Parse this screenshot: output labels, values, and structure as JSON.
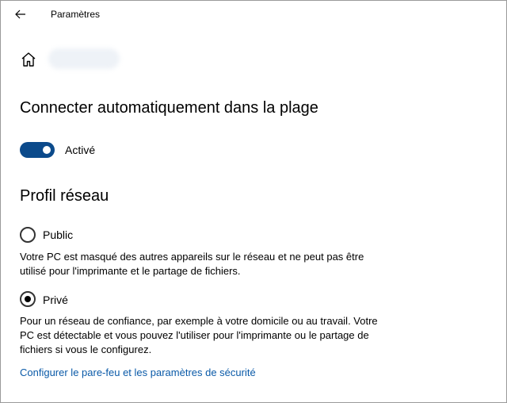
{
  "window": {
    "title": "Paramètres"
  },
  "icons": {
    "back": "back-arrow-icon",
    "home": "home-icon"
  },
  "auto_connect": {
    "heading": "Connecter automatiquement dans la plage",
    "toggle_state": "on",
    "toggle_label": "Activé",
    "accent_color": "#0b4a8b"
  },
  "network_profile": {
    "heading": "Profil réseau",
    "options": [
      {
        "label": "Public",
        "selected": false,
        "description": "Votre PC est masqué des autres appareils sur le réseau et ne peut pas être utilisé pour l'imprimante et le partage de fichiers."
      },
      {
        "label": "Privé",
        "selected": true,
        "description": "Pour un réseau de confiance, par exemple à votre domicile ou au travail. Votre PC est détectable et vous pouvez l'utiliser pour l'imprimante ou le partage de fichiers si vous le configurez."
      }
    ]
  },
  "firewall_link": {
    "label": "Configurer le pare-feu et les paramètres de sécurité",
    "color": "#0a5aa8"
  }
}
